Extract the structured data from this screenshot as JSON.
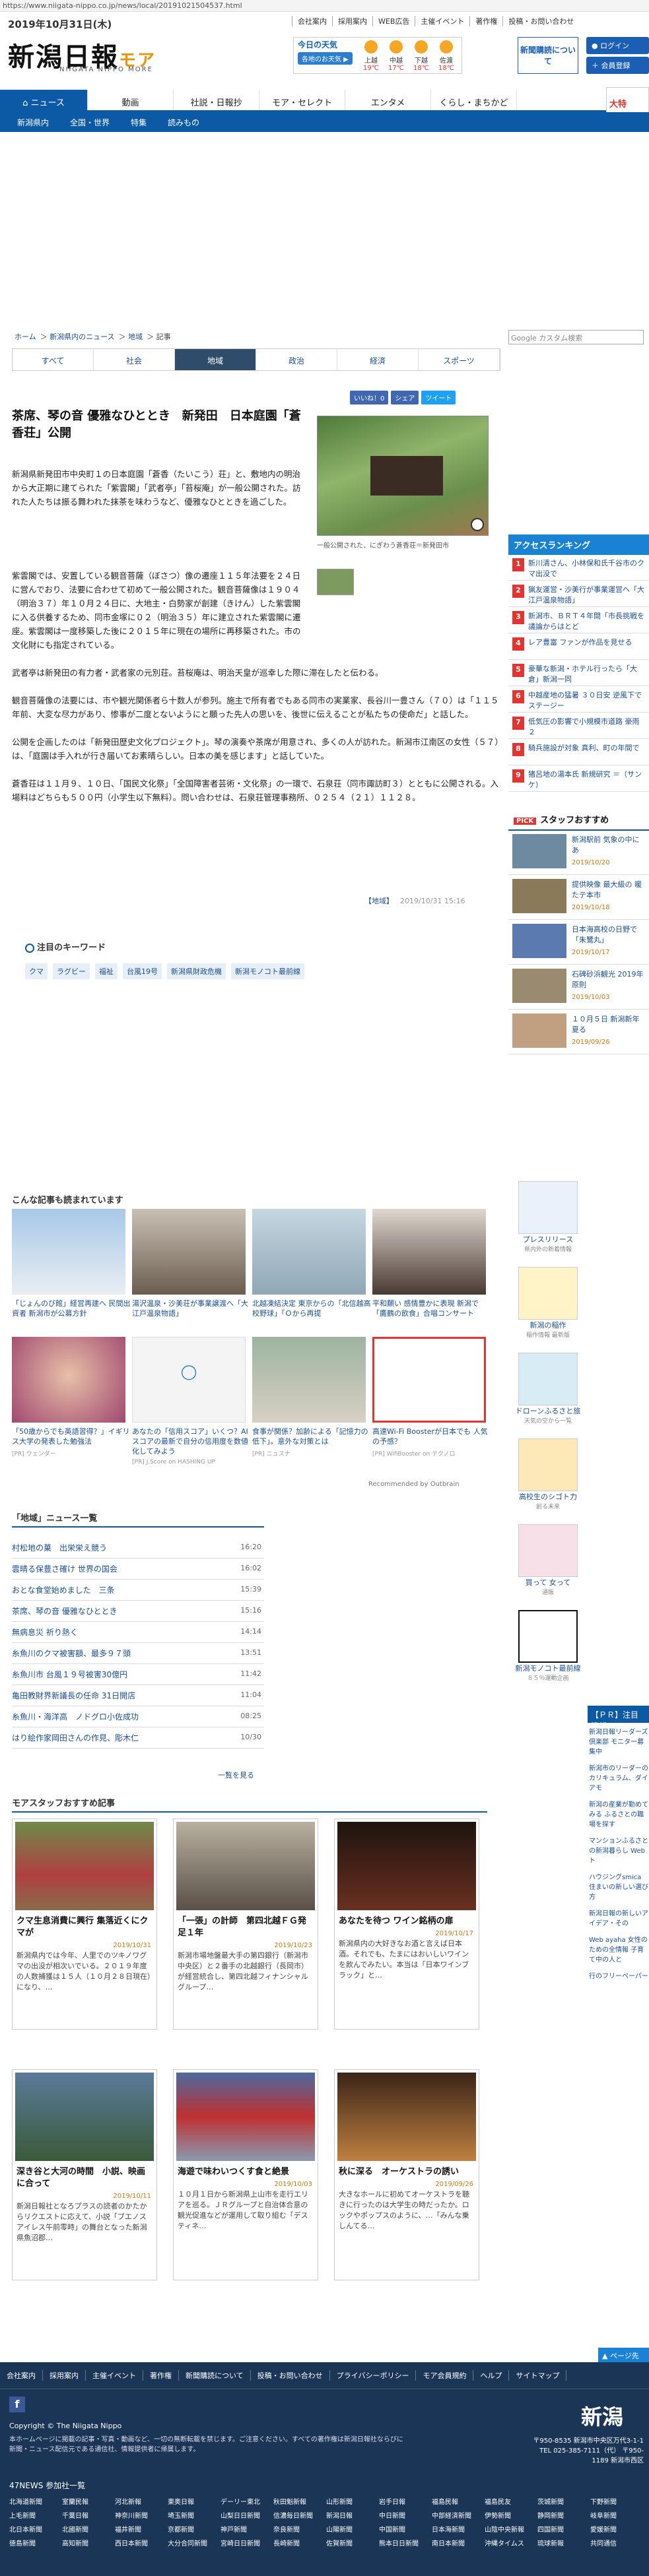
{
  "url": "https://www.niigata-nippo.co.jp/news/local/20191021504537.html",
  "date": "2019年10月31日(木)",
  "toplinks": [
    "会社案内",
    "採用案内",
    "WEB広告",
    "主催イベント",
    "著作権",
    "投稿・お問い合わせ"
  ],
  "logo": {
    "main": "新潟日報",
    "sub": "モア",
    "en": "NIIGATA NIPPO MORE"
  },
  "weather": {
    "title": "今日の天気",
    "button": "各地のお天気 ▶",
    "cities": [
      {
        "name": "上越",
        "temp": "19℃"
      },
      {
        "name": "中越",
        "temp": "17℃"
      },
      {
        "name": "下越",
        "temp": "18℃"
      },
      {
        "name": "佐渡",
        "temp": "18℃"
      }
    ]
  },
  "subscribe": "新聞購読について",
  "login": "ログイン",
  "register": "会員登録",
  "nav": [
    "ニュース",
    "動画",
    "社説・日報抄",
    "モア・セレクト",
    "エンタメ",
    "くらし・まちかど"
  ],
  "subnav": [
    "新潟県内",
    "全国・世界",
    "特集",
    "読みもの"
  ],
  "ad_right": "大特",
  "breadcrumb": [
    "ホーム",
    "新潟県内のニュース",
    "地域",
    "記事"
  ],
  "search_placeholder": "Google カスタム検索",
  "tabs": [
    "すべて",
    "社会",
    "地域",
    "政治",
    "経済",
    "スポーツ"
  ],
  "social": [
    "いいね！0",
    "シェア",
    "ツイート"
  ],
  "article": {
    "title": "茶席、琴の音 優雅なひととき　新発田　日本庭園「蒼香荘」公開",
    "caption": "一般公開された、にぎわう蒼香荘＝新発田市",
    "paragraphs": [
      "新潟県新発田市中央町１の日本庭園「蒼香（たいこう）荘」と、敷地内の明治から大正期に建てられた「紫雲閣」「武者亭」「苔桜庵」が一般公開された。訪れた人たちは振る舞われた抹茶を味わうなど、優雅なひとときを過ごした。",
      "紫雲閣では、安置している観音菩薩（ぼさつ）像の遷座１１５年法要を２４日に営んでおり、法要に合わせて初めて一般公開された。観音菩薩像は１９０４（明治３７）年１０月２４日に、大地主・白勢家が創建（きけん）した紫雲閣に入る供養するため、同市金塚に０２（明治３５）年に建立された紫雲閣に遷座。紫雲閣は一度移築した後に２０１５年に現在の場所に再移築された。市の文化財にも指定されている。",
      "武者亭は新発田の有力者・武者家の元別荘。苔桜庵は、明治天皇が巡幸した際に滞在したと伝わる。",
      "観音菩薩像の法要には、市や観光関係者ら十数人が参列。施主で所有者でもある同市の実業家、長谷川一豊さん（７０）は「１１５年前、大変な尽力があり、惨事が二度とないようにと願った先人の思いを、後世に伝えることが私たちの使命だ」と話した。",
      "公開を企画したのは「新発田歴史文化プロジェクト」。琴の演奏や茶席が用意され、多くの人が訪れた。新潟市江南区の女性（５７）は、「庭園は手入れが行き届いてお素晴らしい。日本の美を感じます」と話していた。",
      "蒼香荘は１１月９、１０日、「国民文化祭」「全国障害者芸術・文化祭」の一環で、石泉荘（同市諏訪町３）とともに公開される。入場料はどちらも５００円（小学生以下無料）。問い合わせは、石泉荘管理事務所、０２５４（２１）１１２８。"
    ],
    "category": "【地域】",
    "timestamp": "2019/10/31 15:16"
  },
  "keywords": {
    "title": "注目のキーワード",
    "items": [
      "クマ",
      "ラグビー",
      "福祉",
      "台風19号",
      "新潟県財政危機",
      "新潟モノコト最前線"
    ]
  },
  "ranking": {
    "title": "アクセスランキング",
    "items": [
      "新川清さん、小林保和氏千谷市のクマ出没で",
      "猟友運営・沙美行が事業運営へ「大江戸温泉物語」",
      "新潟市、ＢＲＴ４年間「市長挑戦を議論からはとど",
      "レア豊富 ファンが作品を見せる",
      "豪華な新潟・ホテル行ったら「大倉」新潟一同",
      "中越産地の猛暑 ３０日安 逆風下でステージー",
      "低気圧の影響で小規模市道路 豪雨 ２",
      "騎兵施設が対象 真利、町の年間で",
      "猪呂地の湯本氏 新規研究 ＝（サンケ）"
    ]
  },
  "staff_side": {
    "title": "スタッフおすすめ",
    "items": [
      {
        "text": "新潟駅前 気象の中にあ",
        "date": "2019/10/20"
      },
      {
        "text": "提供映像 最大級の 暖たテ本市",
        "date": "2019/10/18"
      },
      {
        "text": "日本海高校の日野で「朱鷺丸」",
        "date": "2019/10/17"
      },
      {
        "text": "石碑砂浜観光 2019年 原則",
        "date": "2019/10/03"
      },
      {
        "text": "１０月５日 新潟新年 夏る",
        "date": "2019/09/26"
      }
    ]
  },
  "recommended": {
    "title": "こんな記事も読まれています",
    "items": [
      {
        "text": "「じょんのび館」経営再建へ 民間出資者 新潟市が公募方針",
        "src": ""
      },
      {
        "text": "湯沢温泉・沙美荘が事業譲渡へ「大江戸温泉物語」",
        "src": ""
      },
      {
        "text": "北越凍結決定 東京からの「北信越高校野球」「Ｏから再提",
        "src": ""
      },
      {
        "text": "平和願い 感情豊かに表現 新潟で「鷹鶴の飲食」合唱コンサート",
        "src": ""
      },
      {
        "text": "「50歳からでも英語習得？」イギリス大学の発表した勉強法",
        "src": "[PR] ウェンダー"
      },
      {
        "text": "あなたの「信用スコア」いくつ？AIスコアの最新で自分の信用度を数値化してみよう",
        "src": "[PR] J.Score on HASHING UP"
      },
      {
        "text": "食事が関係？加齢による「記憶力の低下」。意外な対策とは",
        "src": "[PR] ニュスナ"
      },
      {
        "text": "高速Wi-Fi Boosterが日本でも 人気の予感？",
        "src": "[PR] WifiBooster on テクノロ"
      }
    ],
    "brand": "Recommended by Outbrain"
  },
  "local_list": {
    "title": "「地域」ニュース一覧",
    "items": [
      {
        "t": "村松地の菓　出栄栄え競う",
        "d": "16:20"
      },
      {
        "t": "雲晴る保豊さ確け 世界の国会",
        "d": "16:02"
      },
      {
        "t": "おとな食堂始めました　三条",
        "d": "15:39"
      },
      {
        "t": "茶席、琴の音 優雅なひととき",
        "d": "15:16"
      },
      {
        "t": "無病息災 祈り熱く",
        "d": "14:14"
      },
      {
        "t": "糸魚川のクマ被害額、最多９７頭",
        "d": "13:51"
      },
      {
        "t": "糸魚川市 台風１９号被害30億円",
        "d": "11:42"
      },
      {
        "t": "亀田教財界新議長の任命 31日開店",
        "d": "11:04"
      },
      {
        "t": "糸魚川・海洋高　ノドグロ小佐成功",
        "d": "08:25"
      },
      {
        "t": "はり絵作家岡田さんの作見、彫木仁",
        "d": "10/30"
      }
    ],
    "more": "一覧を見る"
  },
  "staff_main": {
    "title": "モアスタッフおすすめ記事",
    "items": [
      {
        "t": "クマ生息消費に興行 集落近くにクマが",
        "d": "2019/10/31",
        "x": "新潟県内では今年、人里でのツキノワグマの出没が相次いでいる。２０１９年度の人数捕獲は１５人（１０月２８日現在）になり、…"
      },
      {
        "t": "「一張」の計師　第四北越ＦＧ発足１年",
        "d": "2019/10/23",
        "x": "新潟市場地盤最大手の第四銀行（新潟市中央区）と２番手の北越銀行（長岡市）が経営統合し、第四北越フィナンシャルグループ…"
      },
      {
        "t": "あなたを待つ ワイン銘柄の扉",
        "d": "2019/10/17",
        "x": "新潟県内の大好きなお酒と言えば日本酒。それでも、たまにはおいしいワインを飲んでみたい。本当は「日本ワインブラック」と…"
      },
      {
        "t": "深き谷と大河の時間　小説、映画に合って",
        "d": "2019/10/11",
        "x": "新潟日報社となろプラスの読者のかたからリクエストに応えて、小説「ブエノスアイレス午前零時」の舞台となった新潟県魚沼郡…"
      },
      {
        "t": "海遊で味わいつくす食と絶景",
        "d": "2019/10/03",
        "x": "１０月１日から新潟県上山市を走行エリアを巡る。ＪＲグループと自治体合意の観光促進などが運用して取り組む「デスティネ…"
      },
      {
        "t": "秋に深る　オーケストラの誘い",
        "d": "2019/09/26",
        "x": "大きなホールに初めてオーケストラを聴きに行ったのは大学生の時だったか。ロックやポップスのように、…「みんな乗しんてる…"
      }
    ]
  },
  "pr_side": [
    {
      "t": "プレスリリース",
      "s": "県内外の新着情報"
    },
    {
      "t": "新潟の稲作",
      "s": "稲作情報 最新版"
    },
    {
      "t": "ドローンふるさと旅",
      "s": "天気の空から一覧"
    },
    {
      "t": "高校生のシゴト力",
      "s": "創る未来"
    },
    {
      "t": "買って 女って",
      "s": "通販"
    },
    {
      "t": "新潟モノコト最前線",
      "s": "８５％運動企画"
    }
  ],
  "pr_note": {
    "title": "【ＰＲ】注目情報",
    "items": [
      "新潟日報リーダーズ倶楽部 モニター募集中",
      "新潟市のリーダーのカリキュラム、ダイアモ",
      "新潟の産業が勤めてみる ふるさとの職場を探す",
      "マンションふるさとの新潟暮らし Web ト",
      "ハウジングsmica 住まいの新しい選び方",
      "新潟日報の新しいアイデア・その",
      "Web ayaha 女性のための全情報 子育て中の人と",
      "行のフリーペーパー"
    ]
  },
  "footer": {
    "links": [
      "会社案内",
      "採用案内",
      "主催イベント",
      "著作権",
      "新聞購読について",
      "投稿・お問い合わせ",
      "プライバシーポリシー",
      "モア会員規約",
      "ヘルプ",
      "サイトマップ"
    ],
    "copyright": "Copyright © The Niigata Nippo",
    "note": "本ホームページに掲載の記事・写真・動画など、一切の無断転載を禁じます。ご注意ください。すべての著作権は新潟日報社ならびに新聞・ニュース配信元である通信社、情報提供者に帰属します。",
    "logo": "新潟",
    "tel": "〒950-8535 新潟市中央区万代3-1-1 TEL 025-385-7111（代） 〒950-1189 新潟市西区",
    "net": "47NEWS 参加社一覧",
    "netlinks": [
      "北海道新聞",
      "室蘭民報",
      "河北新報",
      "東奥日報",
      "デーリー東北",
      "秋田魁新報",
      "山形新聞",
      "岩手日報",
      "福島民報",
      "福島民友",
      "茨城新聞",
      "下野新聞",
      "上毛新聞",
      "千葉日報",
      "神奈川新聞",
      "埼玉新聞",
      "山梨日日新聞",
      "信濃毎日新聞",
      "新潟日報",
      "中日新聞",
      "中部経済新聞",
      "伊勢新聞",
      "静岡新聞",
      "岐阜新聞",
      "北日本新聞",
      "北國新聞",
      "福井新聞",
      "京都新聞",
      "神戸新聞",
      "奈良新聞",
      "山陽新聞",
      "中国新聞",
      "日本海新聞",
      "山陰中央新報",
      "四国新聞",
      "愛媛新聞",
      "徳島新聞",
      "高知新聞",
      "西日本新聞",
      "大分合同新聞",
      "宮崎日日新聞",
      "長崎新聞",
      "佐賀新聞",
      "熊本日日新聞",
      "南日本新聞",
      "沖縄タイムス",
      "琉球新報",
      "共同通信"
    ]
  },
  "backtop": "▲ ページ先頭",
  "colors": {
    "brand": "#0c5aa6",
    "accent": "#e8940c",
    "link": "#1a4e8f"
  }
}
